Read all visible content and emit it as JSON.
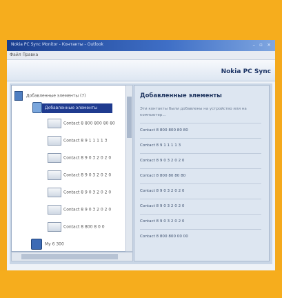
{
  "window": {
    "title": "Nokia PC Sync Monitor - Контакты - Outlook",
    "controls": "– ▫ ×"
  },
  "menubar": {
    "label": "Файл  Правка"
  },
  "banner": {
    "brand": "Nokia PC Sync"
  },
  "tree": {
    "root_label": "Добавленные элементы (7)",
    "selected_label": "Добавленные элементы",
    "items": [
      "Contact 8 800 800 80 80",
      "Contact 8 9 1 1 1 1 3",
      "Contact 8 9 0 3 2 0 2 0",
      "Contact 8 9 0 3 2 0 2 0",
      "Contact 8 9 0 3 2 0 2 0",
      "Contact 8 9 0 3 2 0 2 0",
      "Contact 8 800 8 0 0"
    ],
    "bottom_label": "My 6 300"
  },
  "details": {
    "title": "Добавленные элементы",
    "description": "Эти контакты были добавлены на устройство или на компьютер...",
    "entries": [
      "Contact 8 800 800 80 80",
      "Contact 8 9 1 1 1 1 3",
      "Contact 8 9 0 3 2 0 2 0",
      "Contact 8 800 80 80 80",
      "Contact 8 9 0 3 2 0 2 0",
      "Contact 8 9 0 3 2 0 2 0",
      "Contact 8 9 0 3 2 0 2 0",
      "Contact 8 800 800 00 00"
    ]
  }
}
